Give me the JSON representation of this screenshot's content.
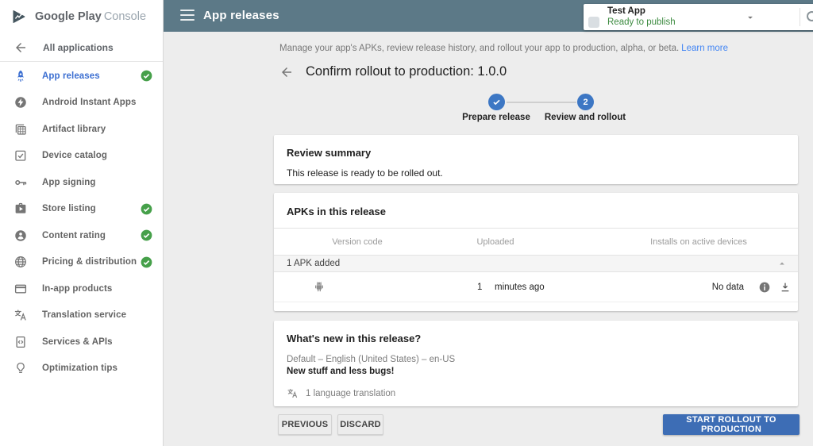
{
  "brand": {
    "name": "Google Play",
    "suffix": "Console"
  },
  "topbar": {
    "title": "App releases",
    "app_selector": {
      "app_name": "Test App",
      "status": "Ready to publish"
    }
  },
  "sidebar": {
    "back_label": "All applications",
    "items": [
      {
        "label": "App releases",
        "icon": "rocket-icon",
        "selected": true,
        "checked": true
      },
      {
        "label": "Android Instant Apps",
        "icon": "instant-apps-icon",
        "selected": false,
        "checked": false
      },
      {
        "label": "Artifact library",
        "icon": "artifact-library-icon",
        "selected": false,
        "checked": false
      },
      {
        "label": "Device catalog",
        "icon": "device-catalog-icon",
        "selected": false,
        "checked": false
      },
      {
        "label": "App signing",
        "icon": "key-icon",
        "selected": false,
        "checked": false
      },
      {
        "label": "Store listing",
        "icon": "storefront-icon",
        "selected": false,
        "checked": true
      },
      {
        "label": "Content rating",
        "icon": "person-circle-icon",
        "selected": false,
        "checked": true
      },
      {
        "label": "Pricing & distribution",
        "icon": "globe-icon",
        "selected": false,
        "checked": true
      },
      {
        "label": "In-app products",
        "icon": "card-icon",
        "selected": false,
        "checked": false
      },
      {
        "label": "Translation service",
        "icon": "translate-icon",
        "selected": false,
        "checked": false
      },
      {
        "label": "Services & APIs",
        "icon": "code-phone-icon",
        "selected": false,
        "checked": false
      },
      {
        "label": "Optimization tips",
        "icon": "lightbulb-icon",
        "selected": false,
        "checked": false
      }
    ]
  },
  "main": {
    "description": "Manage your app's APKs, review release history, and rollout your app to production, alpha, or beta.",
    "learn_more": "Learn more",
    "page_title": "Confirm rollout to production: 1.0.0",
    "stepper": {
      "step1_label": "Prepare release",
      "step2_label": "Review and rollout",
      "step2_number": "2"
    },
    "review_summary": {
      "title": "Review summary",
      "body": "This release is ready to be rolled out."
    },
    "apks": {
      "title": "APKs in this release",
      "columns": [
        "Version code",
        "Uploaded",
        "Installs on active devices"
      ],
      "group_row": "1 APK added",
      "row": {
        "version_code": "1",
        "uploaded": "minutes ago",
        "installs": "No data"
      }
    },
    "whats_new": {
      "title": "What's new in this release?",
      "locale": "Default – English (United States) – en-US",
      "notes": "New stuff and less bugs!",
      "translations": "1 language translation"
    },
    "actions": {
      "previous": "PREVIOUS",
      "discard": "DISCARD",
      "start_rollout": "START ROLLOUT TO PRODUCTION"
    }
  },
  "colors": {
    "topbar_bg": "#5c7987",
    "primary_button_blue": "#3d6db5",
    "stepper_blue": "#3d77c4",
    "selected_item_blue": "#3c6fd1",
    "success_green": "#46a04a",
    "status_green": "#3d8b40",
    "link_blue": "#4285f4"
  }
}
